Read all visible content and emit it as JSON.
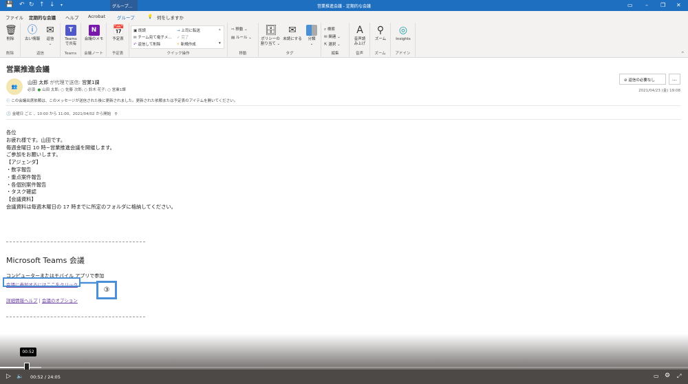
{
  "titlebar": {
    "title": "営業推進会議 - 定期的な会議",
    "context_group": "グループ…",
    "accent": "#1f6fc0"
  },
  "tabs": [
    {
      "label": "ファイル"
    },
    {
      "label": "定期的な会議"
    },
    {
      "label": "ヘルプ"
    },
    {
      "label": "Acrobat"
    },
    {
      "label": "グループ"
    },
    {
      "label": "何をしますか"
    }
  ],
  "ribbon": {
    "delete": {
      "btn": "削除",
      "group": "削除"
    },
    "respond": {
      "old": "古い情報",
      "reply": "返信",
      "group": "返信"
    },
    "teams": {
      "btn1": "Teams",
      "btn2": "で共有",
      "group": "Teams"
    },
    "notes": {
      "btn": "会議のメモ",
      "group": "会議ノート"
    },
    "calendar": {
      "btn": "予定表",
      "group": "予定表"
    },
    "quick": {
      "items": [
        "既読",
        "チーム宛て電子メ…",
        "返信して削除",
        "上司に転送",
        "完了",
        "新規作成"
      ],
      "group": "クイック操作"
    },
    "move": {
      "items": [
        "移動 ⌄",
        "ルール ⌄"
      ],
      "group": "移動"
    },
    "tags": {
      "policy1": "ポリシーの",
      "policy2": "割り当て ⌄",
      "unread": "未読にする",
      "categorize": "分類",
      "group": "タグ"
    },
    "edit": {
      "items": [
        "検索",
        "関連 ⌄",
        "選択 ⌄"
      ],
      "group": "編集"
    },
    "speech": {
      "btn1": "音声読",
      "btn2": "み上げ",
      "group": "音声"
    },
    "zoom": {
      "btn": "ズーム",
      "group": "ズーム"
    },
    "addin": {
      "btn": "Insights",
      "group": "アドイン"
    }
  },
  "message": {
    "subject": "営業推進会議",
    "sender": "山田 太郎",
    "on_behalf": "が代理で送信:",
    "organizer": "営業1課",
    "avatar_text": "営業一課",
    "required_label": "必須",
    "attendees": [
      "山田 太郎;",
      "佐藤 次郎;",
      "鈴木 花子;",
      "営業1課"
    ],
    "info": "この会議出席依頼は、このメッセージが送信された後に更新されました。更新された依頼または予定表のアイテムを開いてください。",
    "recurrence": "金曜日 ごと 、10:00 から 11:00、2021/04/02 から開始",
    "no_reply_button": "返信の必要なし",
    "more_button": "…",
    "date": "2021/04/23 (金) 19:08",
    "body": [
      "各位",
      "お疲れ様です。山田です。",
      "毎週金曜日 10 時~営業推進会議を開催します。",
      "ご参加をお願いします。",
      "【アジェンダ】",
      "・数字報告",
      "・重点案件報告",
      "・各個別案件報告",
      "・タスク確認",
      "【会議資料】",
      "会議資料は毎週木曜日の 17 時までに所定のフォルダに格納してください。"
    ],
    "teams_heading": "Microsoft Teams 会議",
    "teams_sub": "コンピューターまたはモバイル アプリで参加",
    "join_link": "会議に参加するにはここをクリック",
    "callout": "③",
    "help_link": "詳細情報ヘルプ",
    "separator": "|",
    "options_link": "会議のオプション"
  },
  "player": {
    "current": "00:52",
    "separator": "/",
    "total": "24:05",
    "tooltip": "00:52",
    "progress_percent": 3.6,
    "buffered_percent": 6
  }
}
